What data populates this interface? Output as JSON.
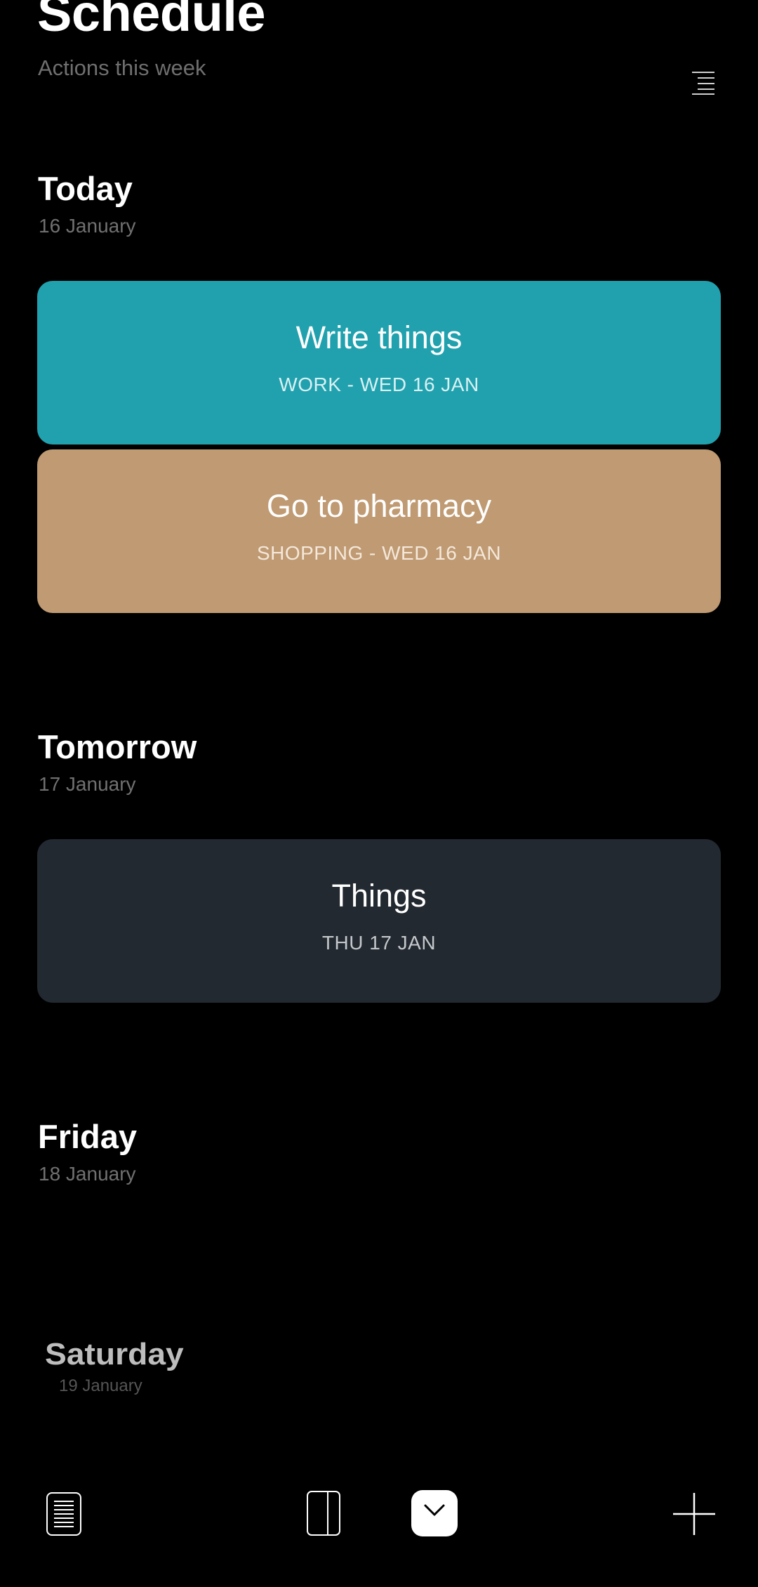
{
  "header": {
    "title": "Schedule",
    "subtitle": "Actions this week",
    "menu_icon": "sort-lines-icon"
  },
  "sections": [
    {
      "title": "Today",
      "date": "16 January",
      "cards": [
        {
          "title": "Write things",
          "subtitle": "WORK - WED 16 JAN",
          "color": "#21a1ae",
          "subtitle_color": "#d8f1f3"
        },
        {
          "title": "Go to pharmacy",
          "subtitle": "SHOPPING - WED 16 JAN",
          "color": "#bf9a72",
          "subtitle_color": "#f4e8db"
        }
      ]
    },
    {
      "title": "Tomorrow",
      "date": "17 January",
      "cards": [
        {
          "title": "Things",
          "subtitle": "THU 17 JAN",
          "color": "#232930",
          "subtitle_color": "#c4c8cc"
        }
      ]
    },
    {
      "title": "Friday",
      "date": "18 January",
      "cards": []
    },
    {
      "title": "Saturday",
      "date": "19 January",
      "cards": []
    }
  ],
  "bottom_nav": [
    {
      "icon": "notes-list-icon"
    },
    {
      "icon": "split-panel-icon"
    },
    {
      "icon": "clock-icon",
      "active": true
    },
    {
      "icon": "plus-icon"
    }
  ],
  "colors": {
    "background": "#000000",
    "secondary_text": "#707070"
  }
}
